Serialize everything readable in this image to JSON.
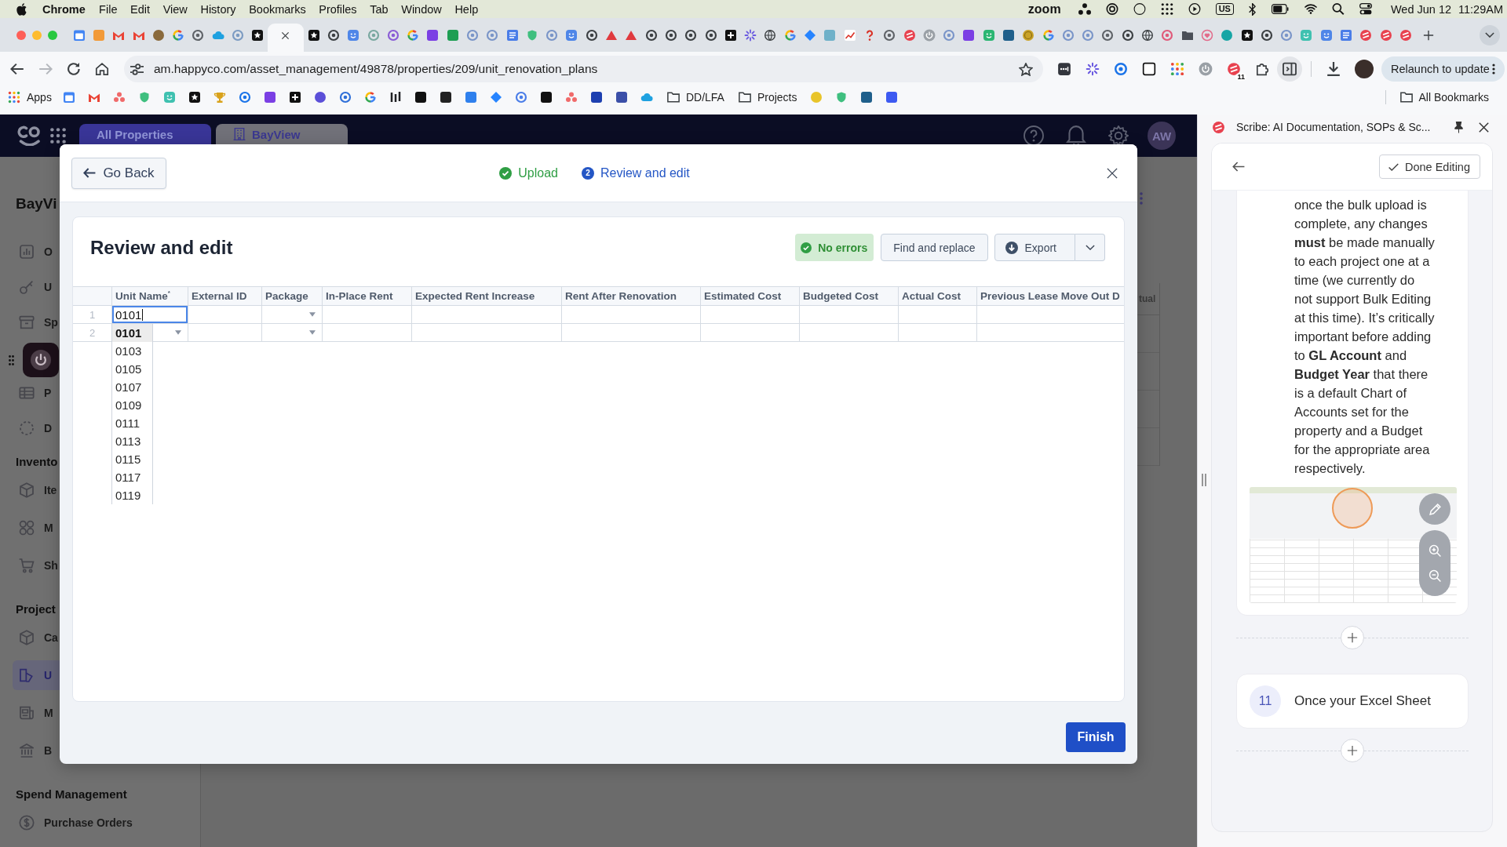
{
  "menu_bar": {
    "app_name": "Chrome",
    "menus": [
      "File",
      "Edit",
      "View",
      "History",
      "Bookmarks",
      "Profiles",
      "Tab",
      "Window",
      "Help"
    ],
    "zoom_label": "zoom",
    "input_source": "US",
    "date": "Wed Jun 12",
    "time": "11:29AM"
  },
  "browser": {
    "tabs": [
      {
        "selected": false
      },
      {
        "selected": false
      },
      {
        "selected": false
      },
      {
        "selected": false
      },
      {
        "selected": false
      },
      {
        "selected": false
      },
      {
        "selected": false
      },
      {
        "selected": false
      },
      {
        "selected": false
      },
      {
        "selected": false
      },
      {
        "selected": true
      },
      {
        "selected": false
      },
      {
        "selected": false
      },
      {
        "selected": false
      },
      {
        "selected": false
      },
      {
        "selected": false
      },
      {
        "selected": false
      },
      {
        "selected": false
      },
      {
        "selected": false
      },
      {
        "selected": false
      },
      {
        "selected": false
      },
      {
        "selected": false
      },
      {
        "selected": false
      },
      {
        "selected": false
      },
      {
        "selected": false
      },
      {
        "selected": false
      },
      {
        "selected": false
      },
      {
        "selected": false
      },
      {
        "selected": false
      },
      {
        "selected": false
      },
      {
        "selected": false
      },
      {
        "selected": false
      },
      {
        "selected": false
      },
      {
        "selected": false
      },
      {
        "selected": false
      },
      {
        "selected": false
      },
      {
        "selected": false
      },
      {
        "selected": false
      },
      {
        "selected": false
      },
      {
        "selected": false
      },
      {
        "selected": false
      },
      {
        "selected": false
      },
      {
        "selected": false
      },
      {
        "selected": false
      },
      {
        "selected": false
      },
      {
        "selected": false
      },
      {
        "selected": false
      },
      {
        "selected": false
      },
      {
        "selected": false
      },
      {
        "selected": false
      },
      {
        "selected": false
      },
      {
        "selected": false
      },
      {
        "selected": false
      },
      {
        "selected": false
      },
      {
        "selected": false
      },
      {
        "selected": false
      },
      {
        "selected": false
      },
      {
        "selected": false
      },
      {
        "selected": false
      },
      {
        "selected": false
      },
      {
        "selected": false
      },
      {
        "selected": false
      },
      {
        "selected": false
      },
      {
        "selected": false
      },
      {
        "selected": false
      },
      {
        "selected": false
      },
      {
        "selected": false
      }
    ],
    "url": "am.happyco.com/asset_management/49878/properties/209/unit_renovation_plans",
    "extension_badge": "11",
    "relaunch_button": "Relaunch to update",
    "bookmarks_bar": {
      "apps": "Apps",
      "folders": [
        "DD/LFA",
        "Projects"
      ],
      "all_bookmarks": "All Bookmarks"
    }
  },
  "app": {
    "header_tabs": [
      {
        "label": "All Properties",
        "selected": false
      },
      {
        "label": "BayView",
        "selected": true
      }
    ],
    "avatar_initials": "AW",
    "sidebar": {
      "title": "BayVi",
      "sections": [
        {
          "items": [
            {
              "label": "O",
              "selected": false
            },
            {
              "label": "U",
              "selected": false
            },
            {
              "label": "Sp",
              "selected": false
            },
            {
              "label": "P",
              "selected": false
            },
            {
              "label": "D",
              "selected": false
            }
          ]
        },
        {
          "heading": "Invento",
          "items": [
            {
              "label": "Ite",
              "selected": false
            },
            {
              "label": "M",
              "selected": false
            },
            {
              "label": "Sh",
              "selected": false
            }
          ]
        },
        {
          "heading": "Project",
          "items": [
            {
              "label": "Ca",
              "selected": false
            },
            {
              "label": "U",
              "selected": true
            },
            {
              "label": "M",
              "selected": false
            },
            {
              "label": "B",
              "selected": false
            }
          ]
        },
        {
          "heading": "Spend Management",
          "items": [
            {
              "label": "Purchase Orders",
              "selected": false
            }
          ]
        }
      ]
    },
    "background_table": {
      "column_header": "tual"
    }
  },
  "modal": {
    "back_button": "Go Back",
    "steps": [
      {
        "label": "Upload",
        "completed": true,
        "selected": false
      },
      {
        "number": "2",
        "label": "Review and edit",
        "completed": false,
        "selected": true
      }
    ],
    "title": "Review and edit",
    "status_badge": "No errors",
    "find_replace_button": "Find and replace",
    "export_button": "Export",
    "table": {
      "columns": [
        {
          "label": "Unit Name$^{*}$",
          "kind": "dropdown"
        },
        {
          "label": "External ID",
          "kind": "text"
        },
        {
          "label": "Package",
          "kind": "dropdown"
        },
        {
          "label": "In-Place Rent",
          "kind": "text"
        },
        {
          "label": "Expected Rent Increase",
          "kind": "text"
        },
        {
          "label": "Rent After Renovation",
          "kind": "text"
        },
        {
          "label": "Estimated Cost",
          "kind": "text"
        },
        {
          "label": "Budgeted Cost",
          "kind": "text"
        },
        {
          "label": "Actual Cost",
          "kind": "text"
        },
        {
          "label": "Previous Lease Move Out D",
          "kind": "text"
        }
      ],
      "rows": [
        {
          "number": "1",
          "editing": true,
          "unit_name": "0101"
        },
        {
          "number": "2",
          "editing": false
        }
      ]
    },
    "unit_options": [
      {
        "label": "0101",
        "selected": true
      },
      {
        "label": "0103",
        "selected": false
      },
      {
        "label": "0105",
        "selected": false
      },
      {
        "label": "0107",
        "selected": false
      },
      {
        "label": "0109",
        "selected": false
      },
      {
        "label": "0111",
        "selected": false
      },
      {
        "label": "0113",
        "selected": false
      },
      {
        "label": "0115",
        "selected": false
      },
      {
        "label": "0117",
        "selected": false
      },
      {
        "label": "0119",
        "selected": false
      }
    ],
    "finish_button": "Finish"
  },
  "side_panel": {
    "title": "Scribe: AI Documentation, SOPs & Sc...",
    "done_button": "Done Editing",
    "steps": [
      {
        "text": "once the bulk upload is complete, any changes **must** be made manually to each project one at a time (we currently do not support Bulk Editing at this time). It’s critically important before adding to **GL Account** and **Budget Year** that there is a default Chart of Accounts set for the property and a Budget for the appropriate area respectively.",
        "image": true
      },
      {
        "number": "11",
        "text": "Once your Excel Sheet",
        "image": false
      }
    ]
  }
}
